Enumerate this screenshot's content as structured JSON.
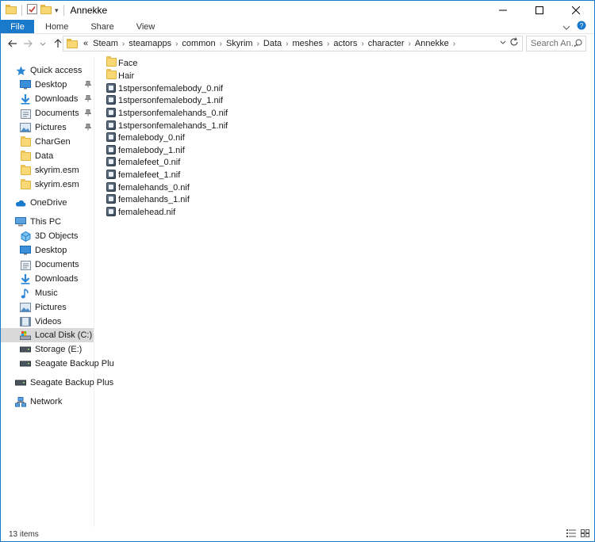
{
  "window": {
    "title": "Annekke",
    "controls": {
      "minimize": "—",
      "maximize": "☐",
      "close": "✕"
    }
  },
  "ribbon": {
    "tabs": [
      "File",
      "Home",
      "Share",
      "View"
    ],
    "collapse_icon": "⌄",
    "help_icon": "?"
  },
  "nav": {
    "back": "←",
    "forward": "→",
    "recent": "⌄",
    "up": "↑"
  },
  "address": {
    "overflow": "«",
    "crumbs": [
      "Steam",
      "steamapps",
      "common",
      "Skyrim",
      "Data",
      "meshes",
      "actors",
      "character",
      "Annekke"
    ],
    "separator": "›"
  },
  "search": {
    "placeholder": "Search An..."
  },
  "sidebar": {
    "quick_access": {
      "label": "Quick access",
      "items": [
        {
          "label": "Desktop",
          "pinned": true,
          "icon": "desktop-icon"
        },
        {
          "label": "Downloads",
          "pinned": true,
          "icon": "downloads-icon"
        },
        {
          "label": "Documents",
          "pinned": true,
          "icon": "documents-icon"
        },
        {
          "label": "Pictures",
          "pinned": true,
          "icon": "pictures-icon"
        },
        {
          "label": "CharGen",
          "pinned": false,
          "icon": "folder-icon"
        },
        {
          "label": "Data",
          "pinned": false,
          "icon": "folder-icon"
        },
        {
          "label": "skyrim.esm",
          "pinned": false,
          "icon": "folder-icon"
        },
        {
          "label": "skyrim.esm",
          "pinned": false,
          "icon": "folder-icon"
        }
      ]
    },
    "onedrive": {
      "label": "OneDrive"
    },
    "this_pc": {
      "label": "This PC",
      "items": [
        {
          "label": "3D Objects",
          "icon": "3d-objects-icon"
        },
        {
          "label": "Desktop",
          "icon": "desktop-icon"
        },
        {
          "label": "Documents",
          "icon": "documents-icon"
        },
        {
          "label": "Downloads",
          "icon": "downloads-icon"
        },
        {
          "label": "Music",
          "icon": "music-icon"
        },
        {
          "label": "Pictures",
          "icon": "pictures-icon"
        },
        {
          "label": "Videos",
          "icon": "videos-icon"
        },
        {
          "label": "Local Disk (C:)",
          "icon": "local-disk-icon",
          "selected": true
        },
        {
          "label": "Storage (E:)",
          "icon": "drive-icon"
        },
        {
          "label": "Seagate Backup Plu",
          "icon": "drive-icon"
        }
      ]
    },
    "seagate": {
      "label": "Seagate Backup Plus"
    },
    "network": {
      "label": "Network"
    }
  },
  "files": [
    {
      "name": "Face",
      "type": "folder"
    },
    {
      "name": "Hair",
      "type": "folder"
    },
    {
      "name": "1stpersonfemalebody_0.nif",
      "type": "nif"
    },
    {
      "name": "1stpersonfemalebody_1.nif",
      "type": "nif"
    },
    {
      "name": "1stpersonfemalehands_0.nif",
      "type": "nif"
    },
    {
      "name": "1stpersonfemalehands_1.nif",
      "type": "nif"
    },
    {
      "name": "femalebody_0.nif",
      "type": "nif"
    },
    {
      "name": "femalebody_1.nif",
      "type": "nif"
    },
    {
      "name": "femalefeet_0.nif",
      "type": "nif"
    },
    {
      "name": "femalefeet_1.nif",
      "type": "nif"
    },
    {
      "name": "femalehands_0.nif",
      "type": "nif"
    },
    {
      "name": "femalehands_1.nif",
      "type": "nif"
    },
    {
      "name": "femalehead.nif",
      "type": "nif"
    }
  ],
  "status": {
    "item_count": "13 items"
  },
  "colors": {
    "accent": "#1979ca",
    "folder": "#f8d775",
    "selected": "#d9d9d9"
  }
}
